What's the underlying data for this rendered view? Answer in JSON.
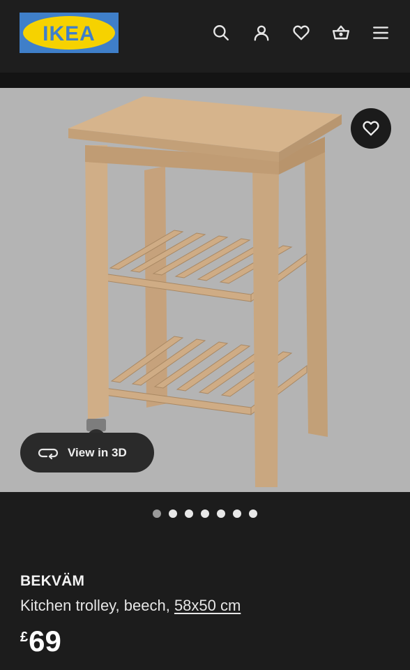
{
  "header": {
    "logo_text": "IKEA",
    "icons": [
      "search-icon",
      "account-icon",
      "heart-icon",
      "basket-icon",
      "menu-icon"
    ]
  },
  "gallery": {
    "view3d_label": "View in 3D",
    "dot_count": 7,
    "active_dot": 0
  },
  "product": {
    "name": "BEKVÄM",
    "description": "Kitchen trolley, beech, ",
    "size": "58x50 cm",
    "currency": "£",
    "price": "69"
  },
  "colors": {
    "logo_blue": "#3f7fc9",
    "logo_yellow": "#f6d200",
    "background": "#1c1c1c",
    "image_bg": "#b4b4b4"
  }
}
